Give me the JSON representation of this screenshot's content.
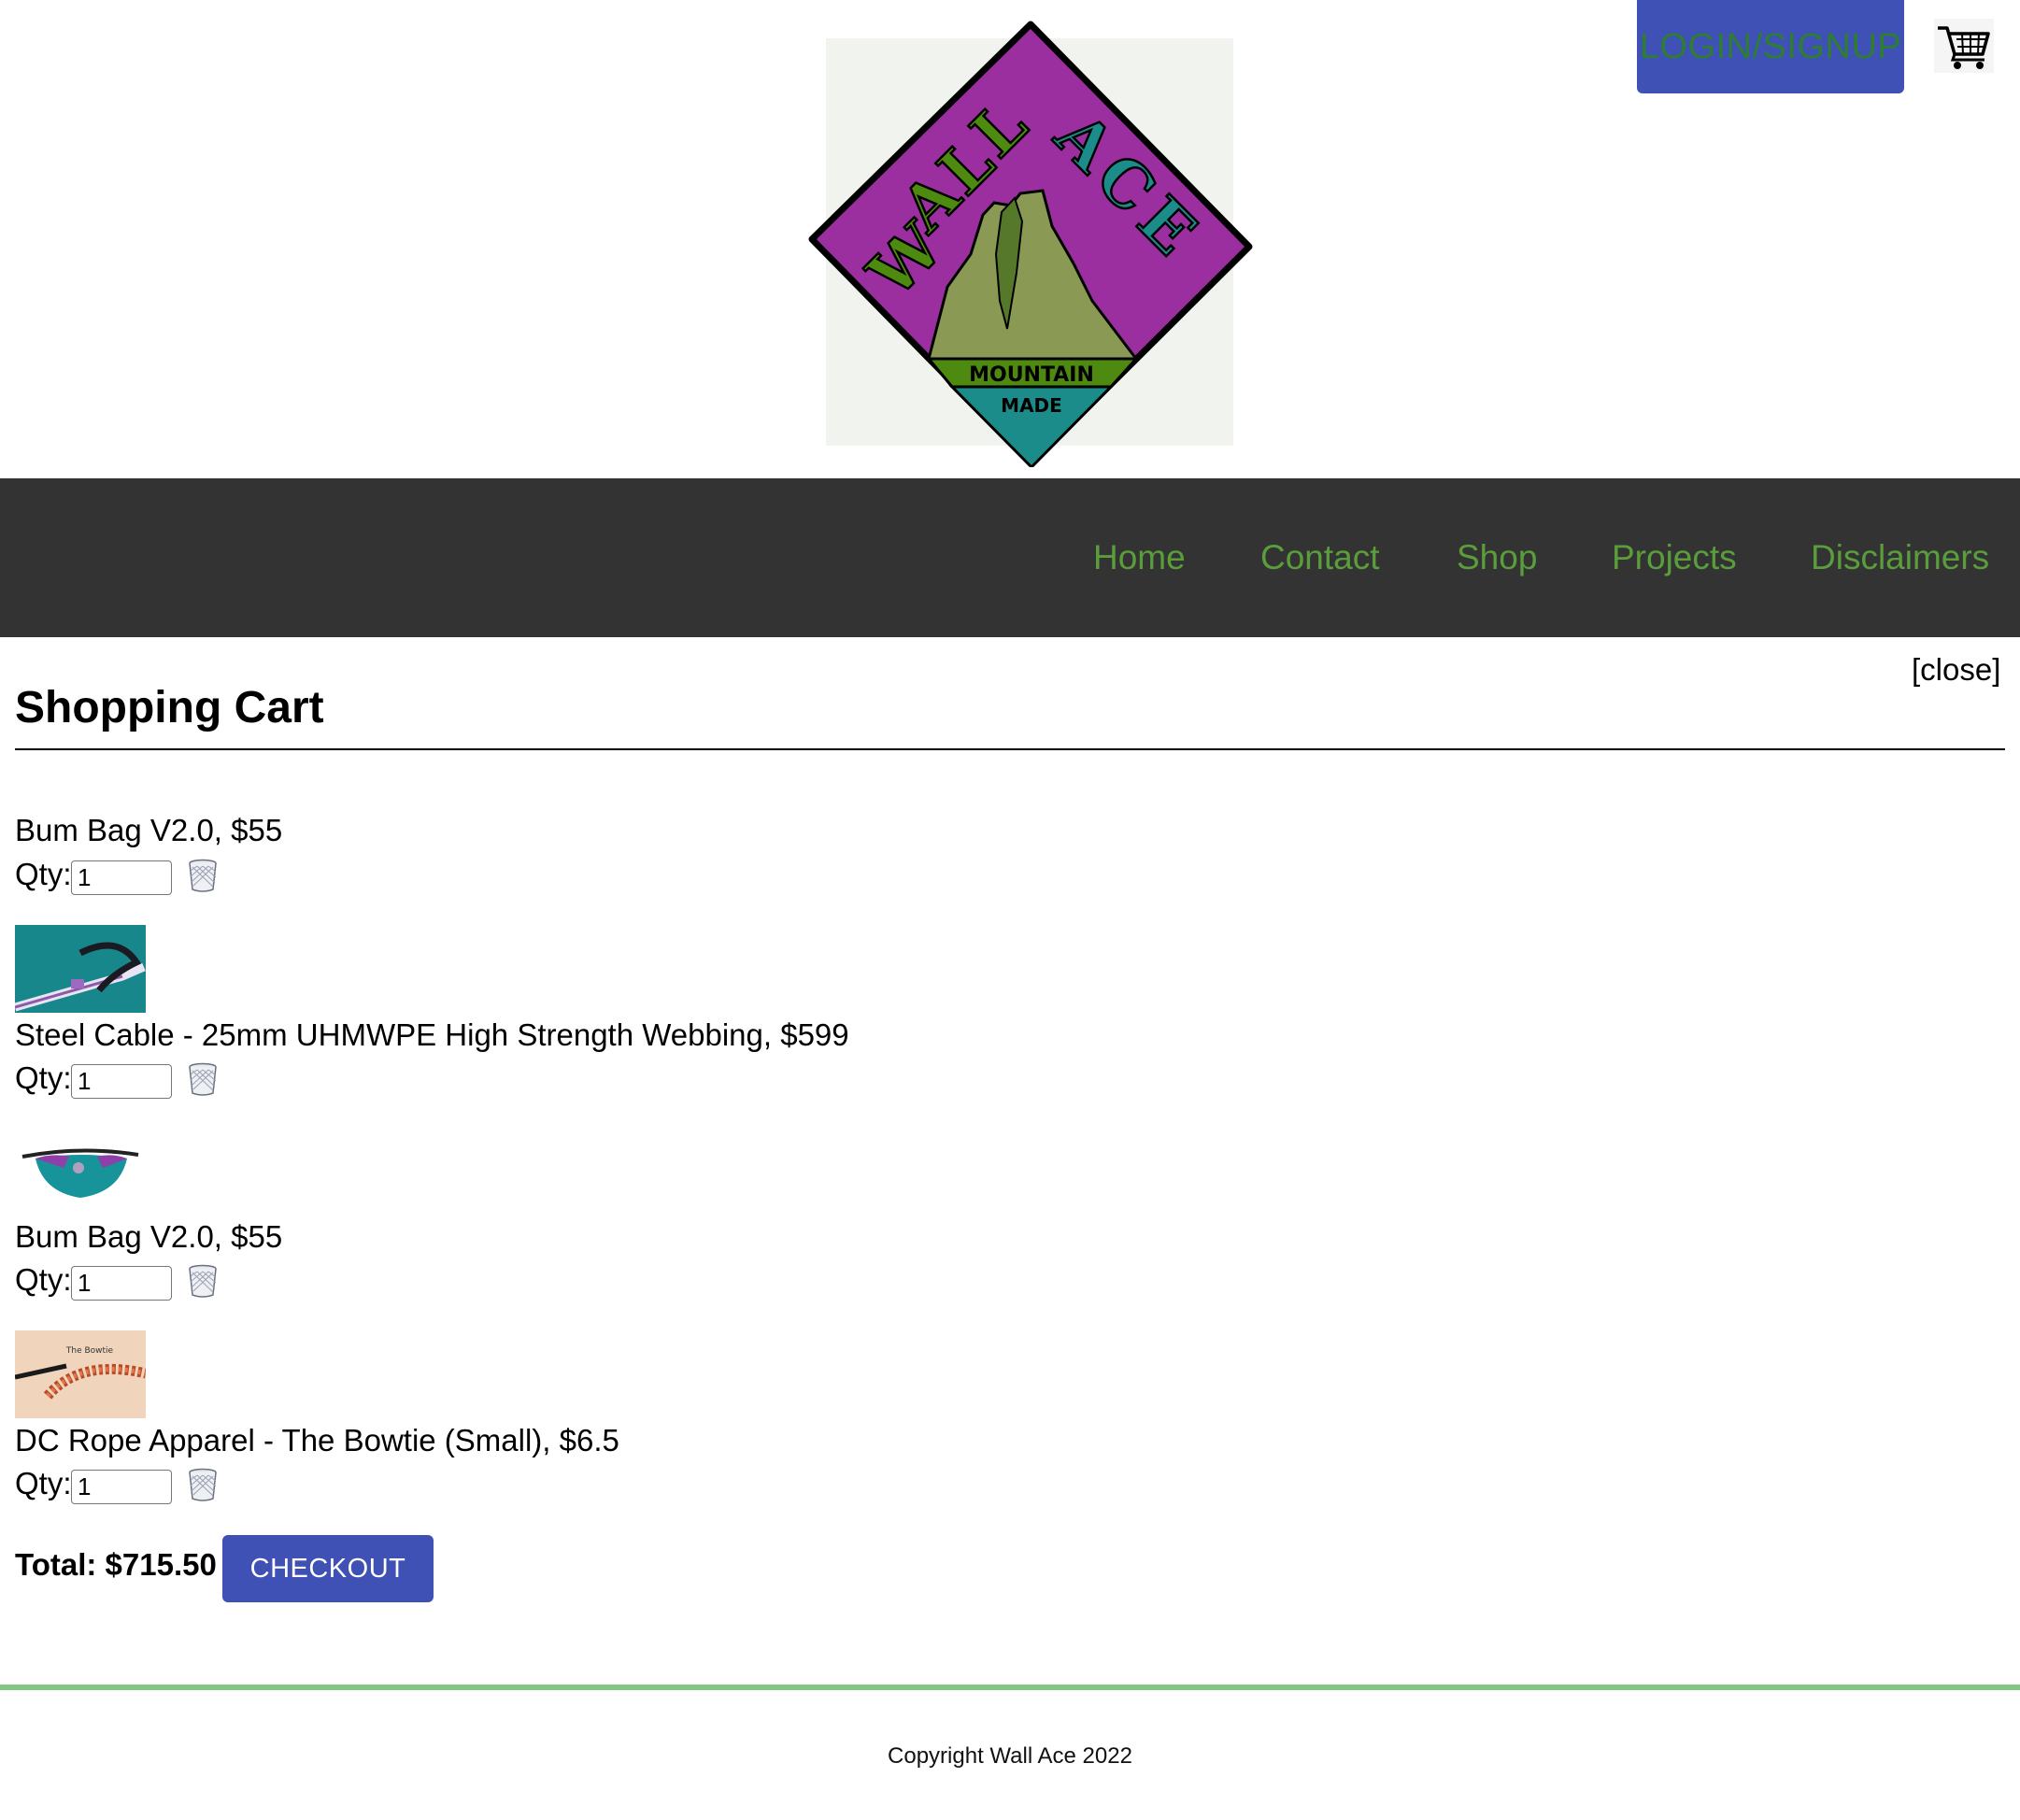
{
  "brand": {
    "logo_text": "WALL ACE",
    "logo_banner_top": "MOUNTAIN",
    "logo_banner_bottom": "MADE",
    "colors": {
      "purple": "#9c2fa0",
      "green": "#4e8a0f",
      "teal": "#1c8c8a",
      "mountain": "#8a9a55",
      "logo_bg": "#f0f3ee"
    }
  },
  "header": {
    "login_label": "LOGIN/SIGNUP",
    "cart_icon": "shopping-cart-icon",
    "login_color": "#3f51b5",
    "login_text_color": "#2e7d32"
  },
  "nav": {
    "background": "#333333",
    "link_color": "#5a9e3c",
    "items": [
      {
        "label": "Home"
      },
      {
        "label": "Contact"
      },
      {
        "label": "Shop"
      },
      {
        "label": "Projects"
      },
      {
        "label": "Disclaimers"
      }
    ]
  },
  "cart": {
    "close_label": "[close]",
    "title": "Shopping Cart",
    "qty_label": "Qty:",
    "trash_icon": "trash-icon",
    "items": [
      {
        "title": "Bum Bag V2.0, $55",
        "qty": "1",
        "image": "none"
      },
      {
        "title": "Steel Cable - 25mm UHMWPE High Strength Webbing, $599",
        "qty": "1",
        "image": "webbing-photo"
      },
      {
        "title": "Bum Bag V2.0, $55",
        "qty": "1",
        "image": "bum-bag-photo"
      },
      {
        "title": "DC Rope Apparel - The Bowtie (Small), $6.5",
        "qty": "1",
        "image": "bowtie-photo",
        "image_caption": "The Bowtie"
      }
    ],
    "total_label": "Total: $715.50",
    "checkout_label": "CHECKOUT"
  },
  "footer": {
    "copyright": "Copyright Wall Ace 2022",
    "rule_color": "#81c784"
  }
}
